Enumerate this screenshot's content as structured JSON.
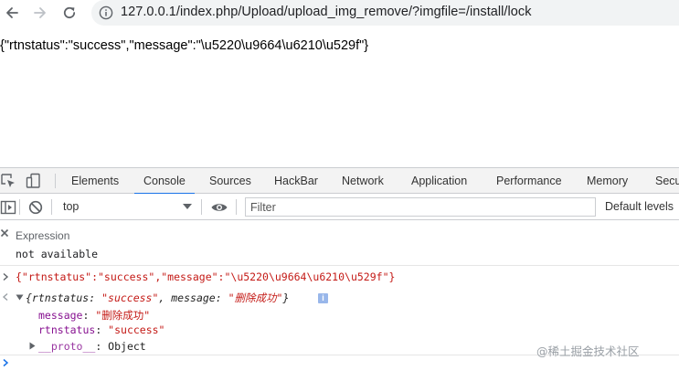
{
  "browser": {
    "url": "127.0.0.1/index.php/Upload/upload_img_remove/?imgfile=/install/lock",
    "icons": [
      "back-arrow-icon",
      "forward-arrow-icon",
      "reload-icon",
      "info-icon"
    ]
  },
  "page": {
    "json_text": "{\"rtnstatus\":\"success\",\"message\":\"\\u5220\\u9664\\u6210\\u529f\"}"
  },
  "devtools": {
    "tabs": [
      "Elements",
      "Console",
      "Sources",
      "HackBar",
      "Network",
      "Application",
      "Performance",
      "Memory",
      "Secu"
    ],
    "active_tab": "Console",
    "context": "top",
    "filter_placeholder": "Filter",
    "levels_label": "Default levels",
    "expression": {
      "label": "Expression",
      "value": "not available"
    },
    "console": {
      "input_line": "{\"rtnstatus\":\"success\",\"message\":\"\\u5220\\u9664\\u6210\\u529f\"}",
      "result_prefix": "{rtnstatus: ",
      "result_status": "\"success\"",
      "result_mid": ", message: ",
      "result_message": "\"删除成功\"",
      "result_suffix": "}",
      "info_badge": "i",
      "props": [
        {
          "key": "message",
          "value": "\"删除成功\""
        },
        {
          "key": "rtnstatus",
          "value": "\"success\""
        }
      ],
      "proto_key": "__proto__",
      "proto_value": "Object"
    }
  },
  "watermark": "@稀土掘金技术社区",
  "colors": {
    "accent": "#1a73e8",
    "string": "#c41a16",
    "key": "#881391"
  }
}
